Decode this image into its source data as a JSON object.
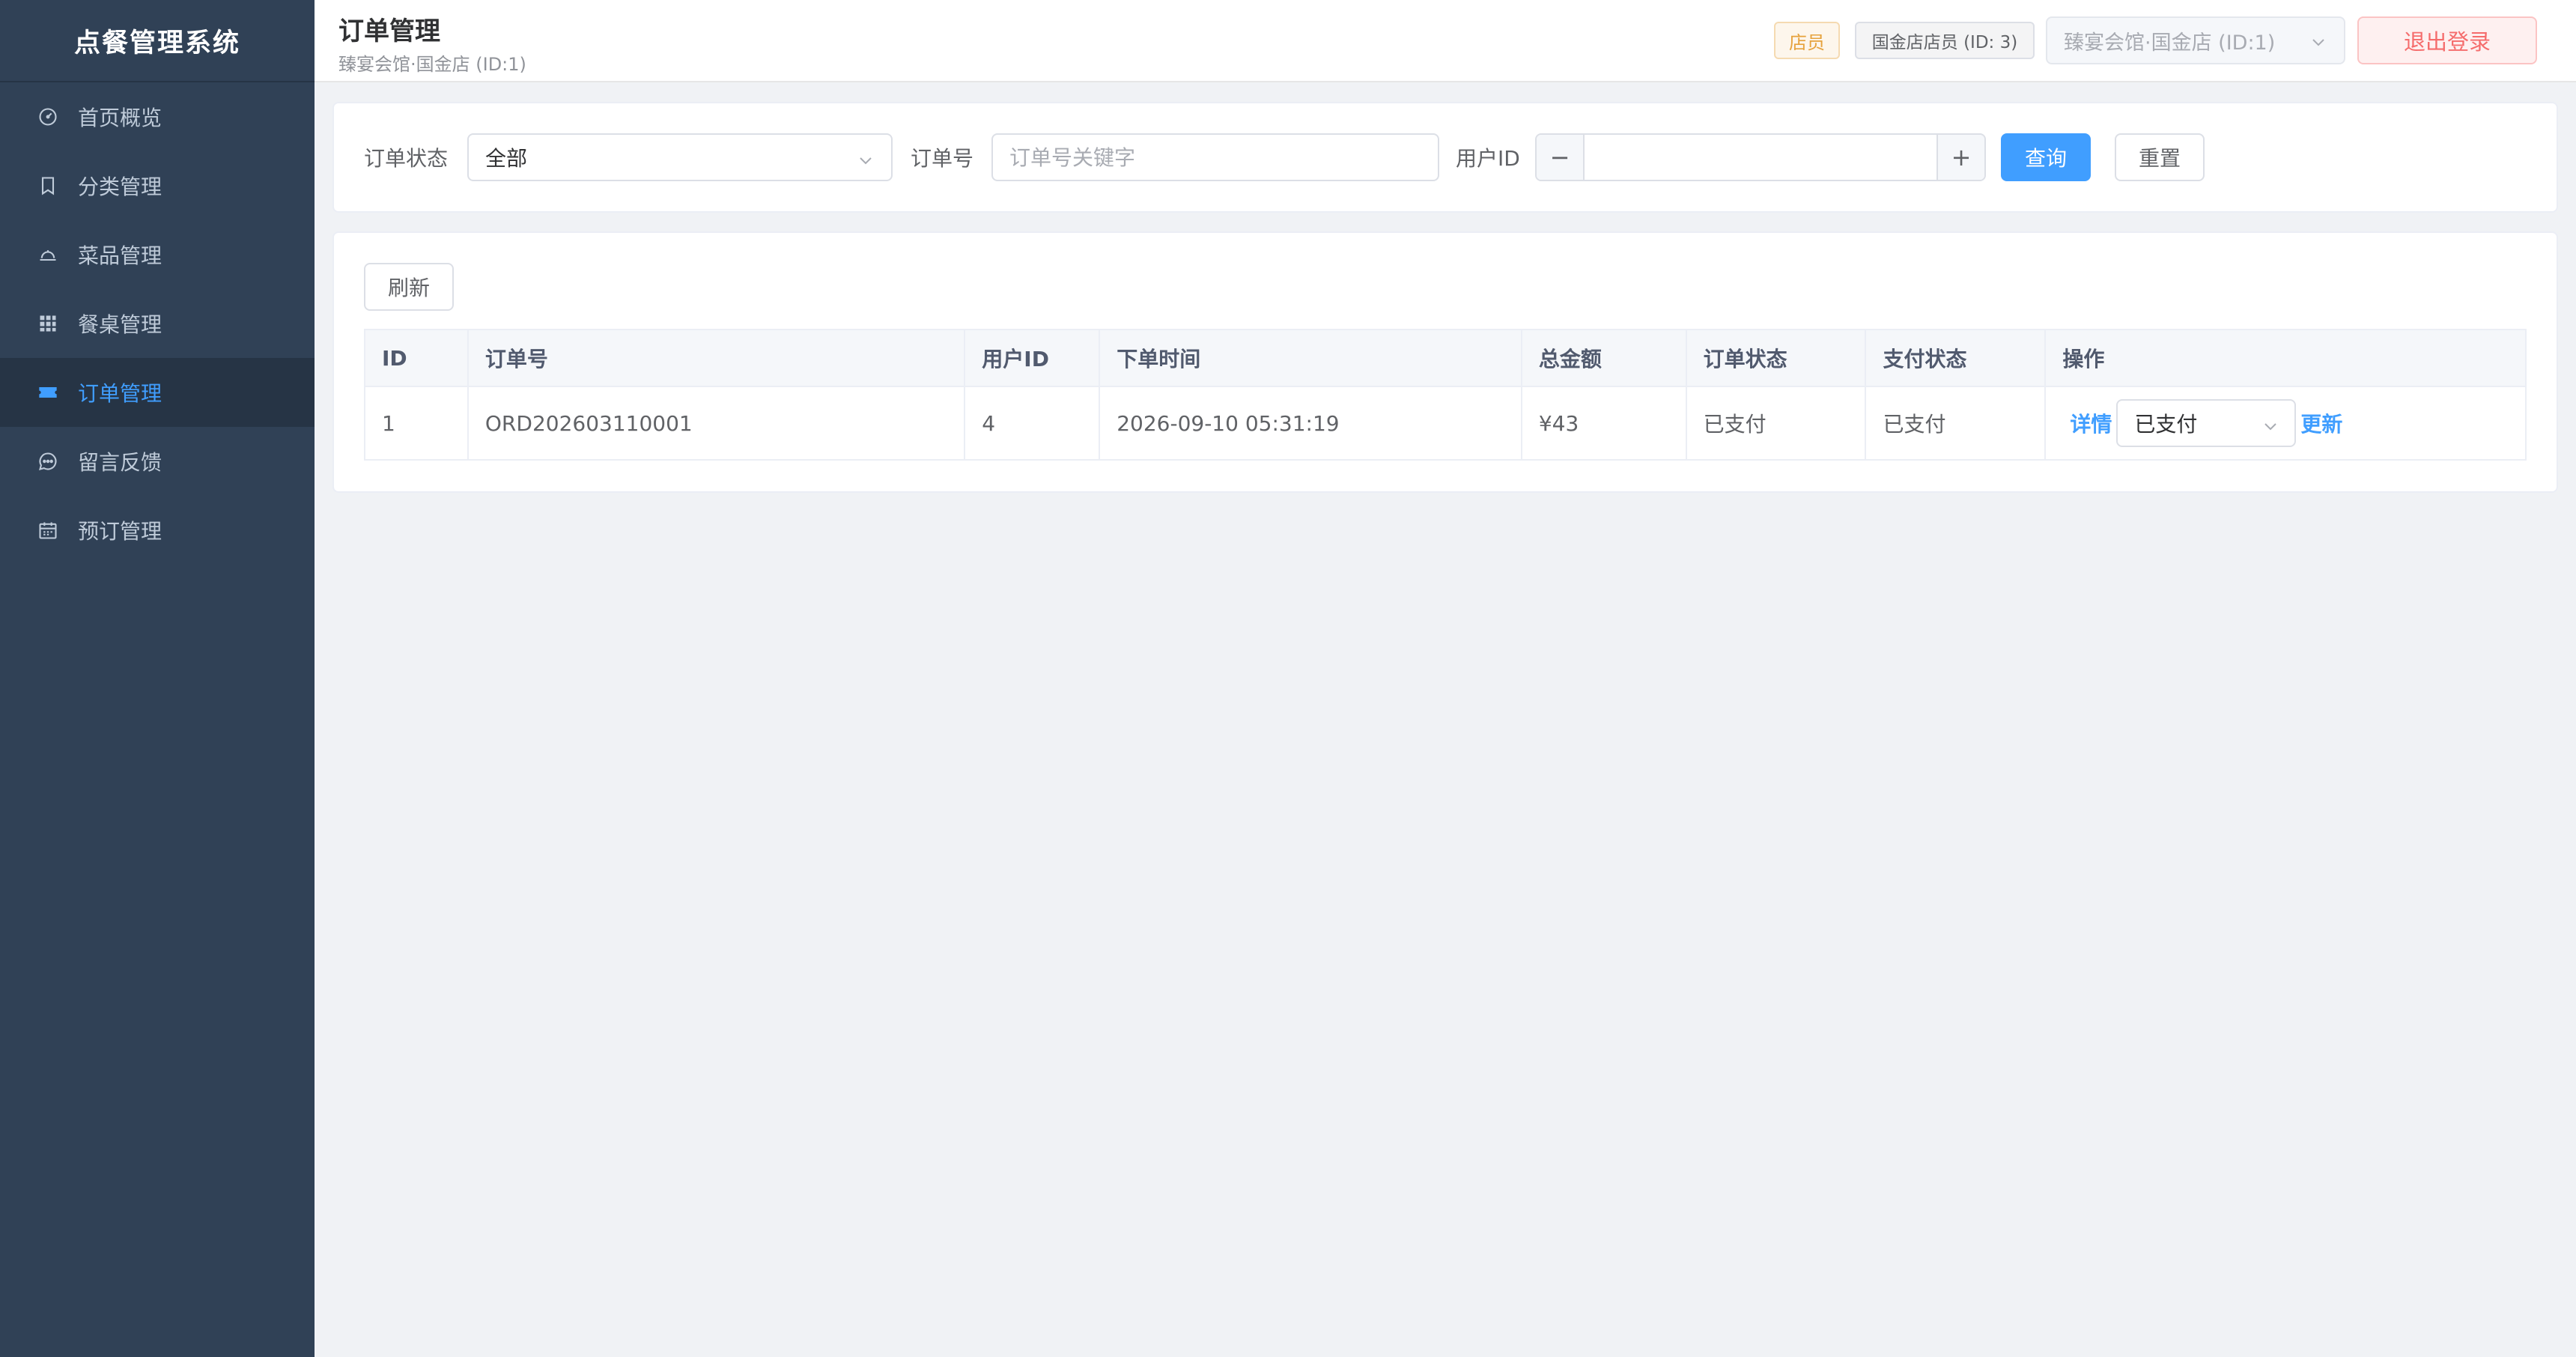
{
  "app": {
    "title": "点餐管理系统"
  },
  "sidebar": {
    "items": [
      {
        "label": "首页概览",
        "icon": "dashboard-icon"
      },
      {
        "label": "分类管理",
        "icon": "bookmark-icon"
      },
      {
        "label": "菜品管理",
        "icon": "dish-cover-icon"
      },
      {
        "label": "餐桌管理",
        "icon": "grid-icon"
      },
      {
        "label": "订单管理",
        "icon": "ticket-icon",
        "active": true
      },
      {
        "label": "留言反馈",
        "icon": "chat-icon"
      },
      {
        "label": "预订管理",
        "icon": "calendar-icon"
      }
    ]
  },
  "header": {
    "title": "订单管理",
    "subtitle": "臻宴会馆·国金店 (ID:1)",
    "role_tag": "店员",
    "user_tag": "国金店店员 (ID: 3)",
    "store_select": "臻宴会馆·国金店 (ID:1)",
    "logout_label": "退出登录"
  },
  "filters": {
    "status_label": "订单状态",
    "status_value": "全部",
    "order_no_label": "订单号",
    "order_no_placeholder": "订单号关键字",
    "order_no_value": "",
    "user_id_label": "用户ID",
    "user_id_value": "",
    "minus": "−",
    "plus": "+",
    "query_label": "查询",
    "reset_label": "重置"
  },
  "table": {
    "refresh_label": "刷新",
    "columns": [
      "ID",
      "订单号",
      "用户ID",
      "下单时间",
      "总金额",
      "订单状态",
      "支付状态",
      "操作"
    ],
    "rows": [
      {
        "id": "1",
        "order_no": "ORD202603110001",
        "user_id": "4",
        "time": "2026-09-10 05:31:19",
        "amount": "¥43",
        "order_status": "已支付",
        "pay_status": "已支付",
        "detail_label": "详情",
        "status_select": "已支付",
        "update_label": "更新"
      }
    ]
  },
  "colors": {
    "sidebar_bg": "#304156",
    "sidebar_active_bg": "#263445",
    "accent": "#409eff",
    "danger": "#f56c6c",
    "warning": "#e6a23c"
  }
}
